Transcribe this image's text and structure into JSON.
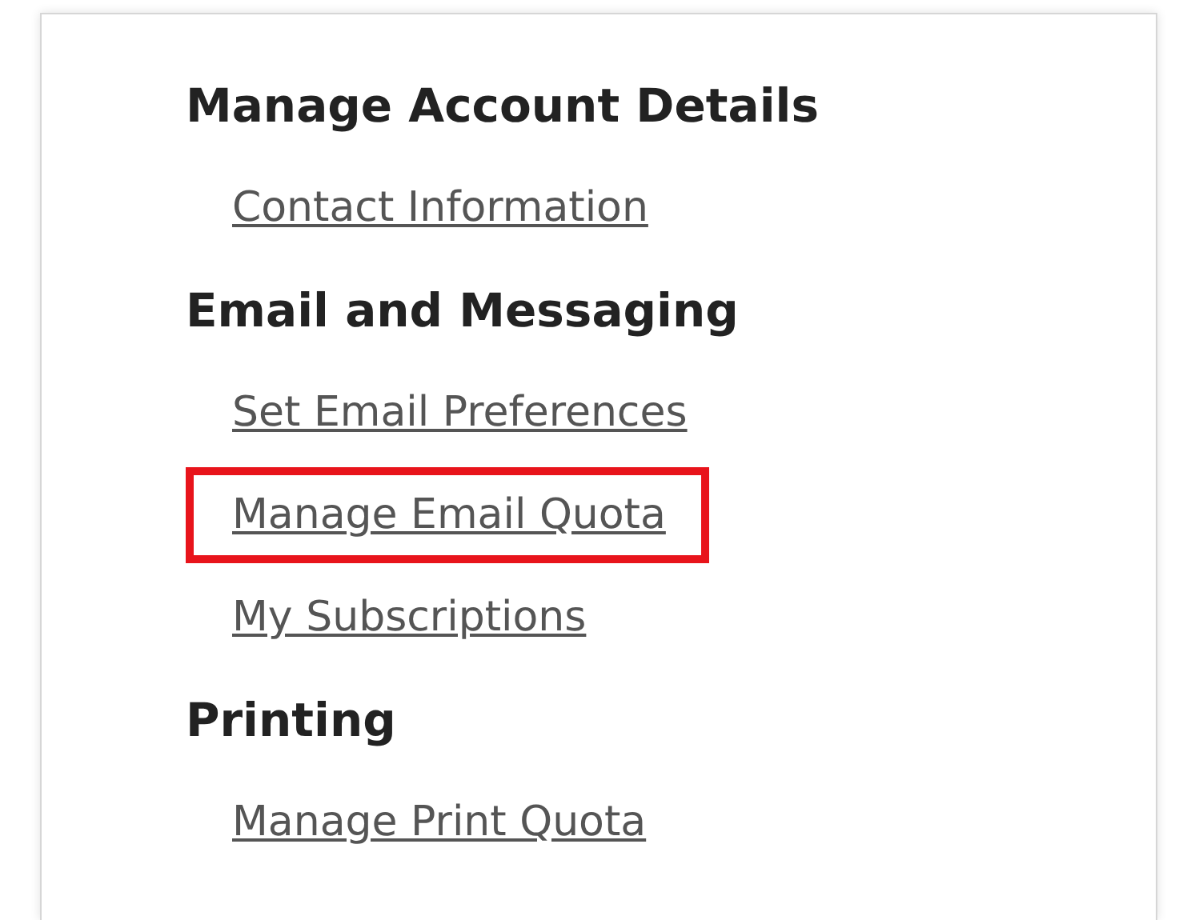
{
  "sections": [
    {
      "heading": "Manage Account Details",
      "links": [
        {
          "label": "Contact Information",
          "highlighted": false
        }
      ]
    },
    {
      "heading": "Email and Messaging",
      "links": [
        {
          "label": "Set Email Preferences",
          "highlighted": false
        },
        {
          "label": "Manage Email Quota",
          "highlighted": true
        },
        {
          "label": "My Subscriptions",
          "highlighted": false
        }
      ]
    },
    {
      "heading": "Printing",
      "links": [
        {
          "label": "Manage Print Quota",
          "highlighted": false
        }
      ]
    }
  ]
}
